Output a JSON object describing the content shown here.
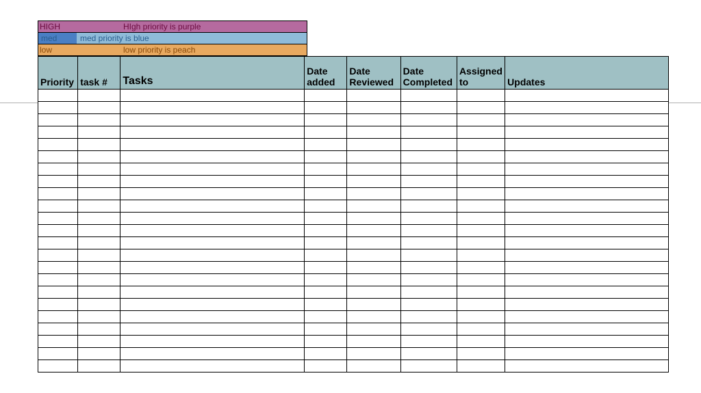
{
  "legend": {
    "rows": [
      {
        "label": "HIGH",
        "desc": "HIgh priority is purple"
      },
      {
        "label": "med",
        "desc": "med priority is blue"
      },
      {
        "label": "low",
        "desc": "low priority is peach"
      }
    ]
  },
  "table": {
    "headers": {
      "priority": "Priority",
      "tasknum": "task #",
      "tasks": "Tasks",
      "dateadded": "Date added",
      "datereviewed": "Date Reviewed",
      "datecompleted": "Date Completed",
      "assignedto": "Assigned to",
      "updates": "Updates"
    },
    "rowCount": 23
  }
}
